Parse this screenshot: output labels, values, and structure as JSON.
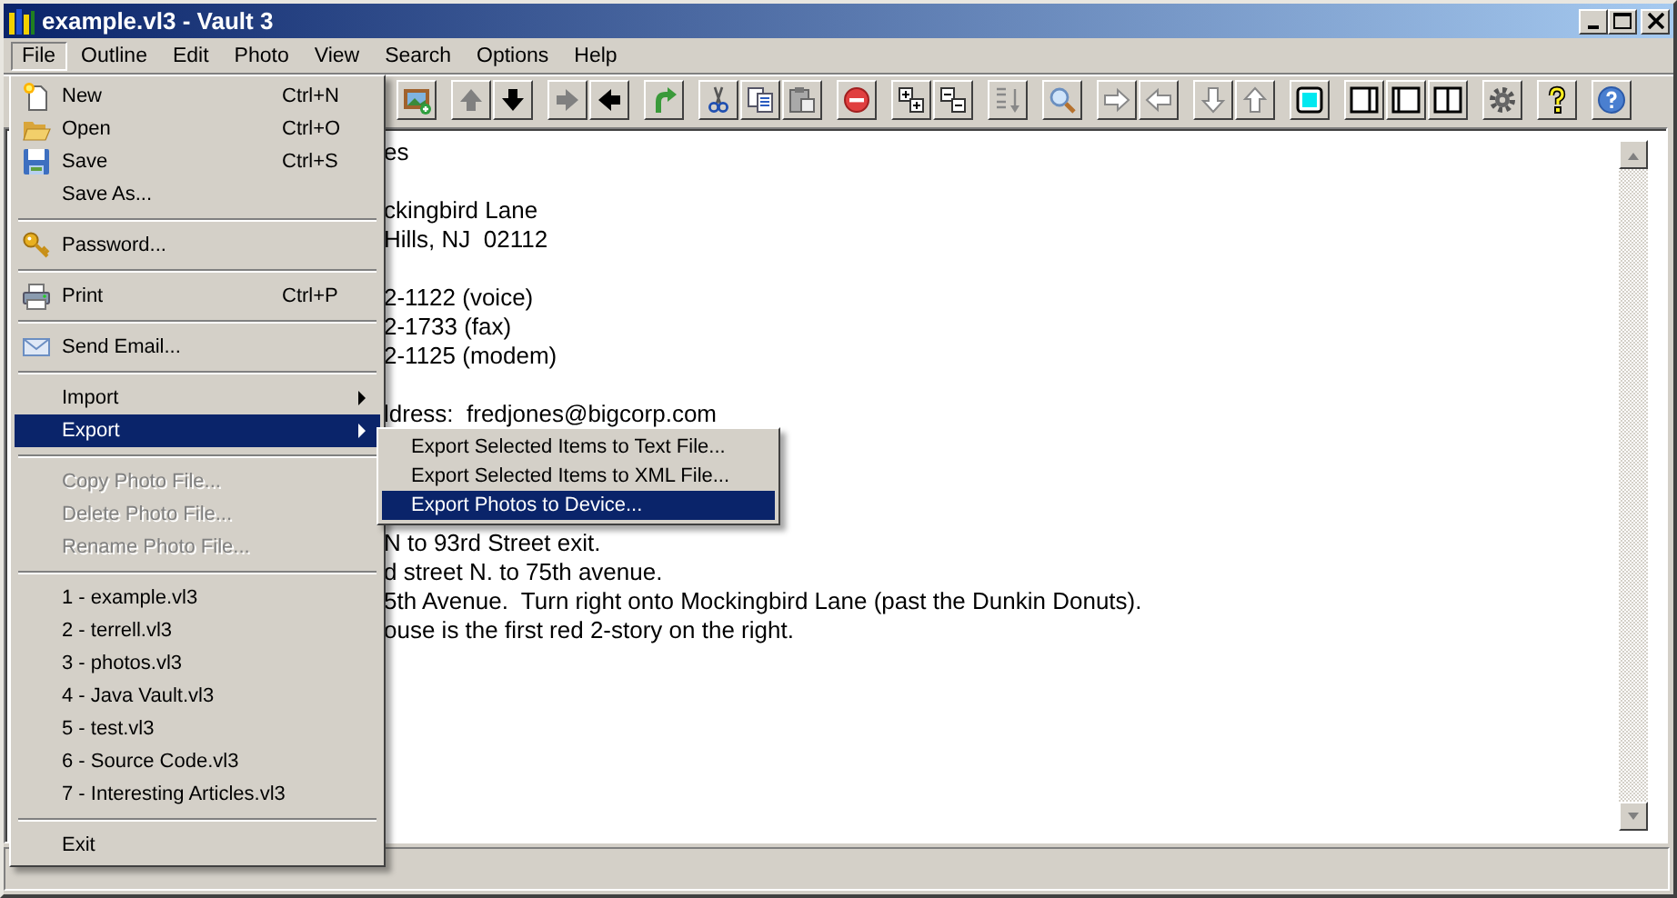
{
  "window": {
    "title": "example.vl3 - Vault 3"
  },
  "menubar": [
    {
      "label": "File",
      "selected": true
    },
    {
      "label": "Outline",
      "selected": false
    },
    {
      "label": "Edit",
      "selected": false
    },
    {
      "label": "Photo",
      "selected": false
    },
    {
      "label": "View",
      "selected": false
    },
    {
      "label": "Search",
      "selected": false
    },
    {
      "label": "Options",
      "selected": false
    },
    {
      "label": "Help",
      "selected": false
    }
  ],
  "editor": {
    "blocks": [
      [
        "es"
      ],
      [
        "ckingbird Lane",
        "Hills, NJ  02112"
      ],
      [
        "2-1122 (voice)",
        "2-1733 (fax)",
        "2-1125 (modem)"
      ],
      [
        "ldress:  fredjones@bigcorp.com"
      ],
      [
        "N to 93rd Street exit.",
        "d street N. to 75th avenue.",
        "5th Avenue.  Turn right onto Mockingbird Lane (past the Dunkin Donuts).",
        "ouse is the first red 2-story on the right."
      ]
    ]
  },
  "file_menu": {
    "items": [
      {
        "kind": "item",
        "label": "New",
        "shortcut": "Ctrl+N",
        "selected": false,
        "disabled": false
      },
      {
        "kind": "item",
        "label": "Open",
        "shortcut": "Ctrl+O",
        "selected": false,
        "disabled": false
      },
      {
        "kind": "item",
        "label": "Save",
        "shortcut": "Ctrl+S",
        "selected": false,
        "disabled": false
      },
      {
        "kind": "item",
        "label": "Save As...",
        "selected": false,
        "disabled": false
      },
      {
        "kind": "separator"
      },
      {
        "kind": "item",
        "label": "Password...",
        "selected": false,
        "disabled": false
      },
      {
        "kind": "separator"
      },
      {
        "kind": "item",
        "label": "Print",
        "shortcut": "Ctrl+P",
        "selected": false,
        "disabled": false
      },
      {
        "kind": "separator"
      },
      {
        "kind": "item",
        "label": "Send Email...",
        "selected": false,
        "disabled": false
      },
      {
        "kind": "separator"
      },
      {
        "kind": "item",
        "label": "Import",
        "selected": false,
        "disabled": false,
        "has_submenu": true
      },
      {
        "kind": "item",
        "label": "Export",
        "selected": true,
        "disabled": false,
        "has_submenu": true,
        "children": [
          {
            "label": "Export Selected Items to Text File...",
            "selected": false
          },
          {
            "label": "Export Selected Items to XML File...",
            "selected": false
          },
          {
            "label": "Export Photos to Device...",
            "selected": true
          }
        ]
      },
      {
        "kind": "separator"
      },
      {
        "kind": "item",
        "label": "Copy Photo File...",
        "selected": false,
        "disabled": true
      },
      {
        "kind": "item",
        "label": "Delete Photo File...",
        "selected": false,
        "disabled": true
      },
      {
        "kind": "item",
        "label": "Rename Photo File...",
        "selected": false,
        "disabled": true
      },
      {
        "kind": "separator"
      },
      {
        "kind": "item",
        "label": "1 - example.vl3",
        "selected": false,
        "disabled": false
      },
      {
        "kind": "item",
        "label": "2 - terrell.vl3",
        "selected": false,
        "disabled": false
      },
      {
        "kind": "item",
        "label": "3 - photos.vl3",
        "selected": false,
        "disabled": false
      },
      {
        "kind": "item",
        "label": "4 - Java Vault.vl3",
        "selected": false,
        "disabled": false
      },
      {
        "kind": "item",
        "label": "5 - test.vl3",
        "selected": false,
        "disabled": false
      },
      {
        "kind": "item",
        "label": "6 - Source Code.vl3",
        "selected": false,
        "disabled": false
      },
      {
        "kind": "item",
        "label": "7 - Interesting Articles.vl3",
        "selected": false,
        "disabled": false
      },
      {
        "kind": "separator"
      },
      {
        "kind": "item",
        "label": "Exit",
        "selected": false,
        "disabled": false
      }
    ]
  }
}
